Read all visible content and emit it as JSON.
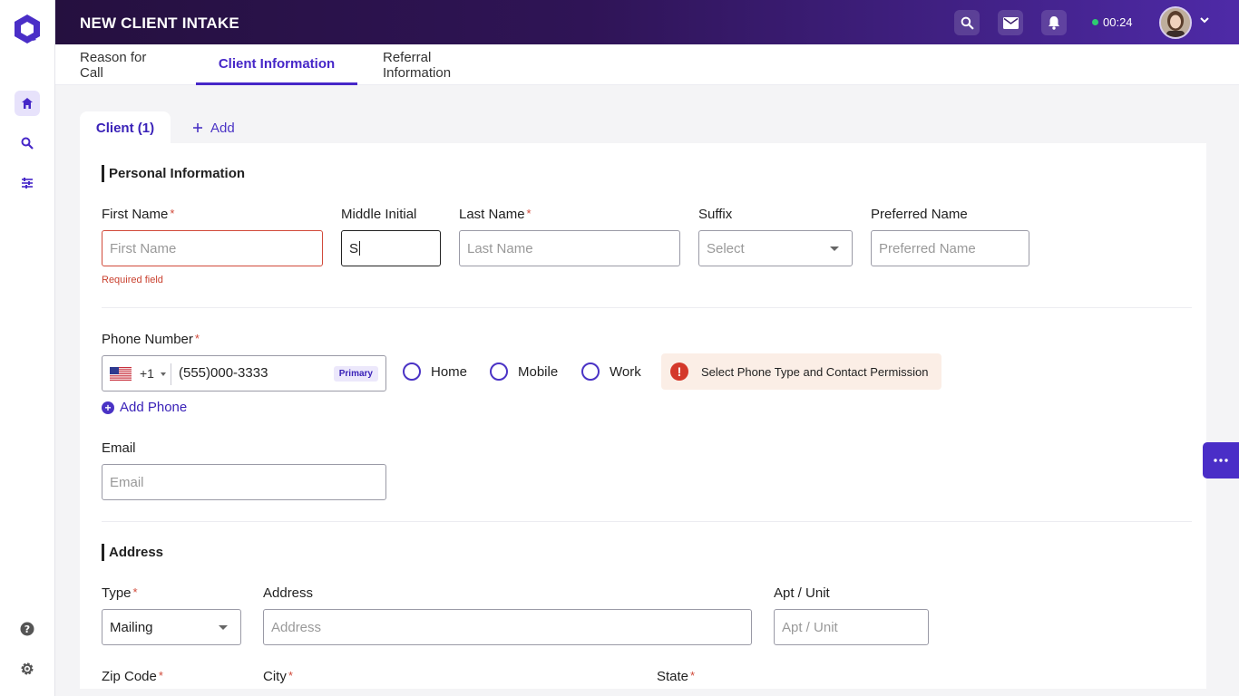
{
  "app": {
    "title": "NEW CLIENT INTAKE",
    "timer": "00:24"
  },
  "icons": {
    "logo": "hexagon-logo-icon",
    "home": "home-icon",
    "search": "search-icon",
    "filters": "sliders-icon",
    "help": "help-icon",
    "settings": "gear-icon",
    "mail": "mail-icon",
    "bell": "bell-icon",
    "more": "more-icon"
  },
  "colors": {
    "accent": "#4627c8",
    "error": "#d14a3a",
    "topbar_start": "#25103f",
    "topbar_end": "#4e2aa7"
  },
  "tabs": [
    {
      "label": "Reason for Call"
    },
    {
      "label": "Client Information"
    },
    {
      "label": "Referral Information"
    }
  ],
  "subtabs": {
    "client": "Client (1)",
    "add": "Add"
  },
  "personal": {
    "title": "Personal Information",
    "first_name": {
      "label": "First Name",
      "placeholder": "First Name",
      "error": "Required field"
    },
    "middle_initial": {
      "label": "Middle Initial",
      "value": "S"
    },
    "last_name": {
      "label": "Last Name",
      "placeholder": "Last Name"
    },
    "suffix": {
      "label": "Suffix",
      "placeholder": "Select"
    },
    "preferred_name": {
      "label": "Preferred Name",
      "placeholder": "Preferred Name"
    }
  },
  "phone": {
    "label": "Phone Number",
    "country_code": "+1",
    "value": "(555)000-3333",
    "badge": "Primary",
    "types": [
      "Home",
      "Mobile",
      "Work"
    ],
    "alert": "Select Phone Type and Contact Permission",
    "add_label": "Add Phone"
  },
  "email": {
    "label": "Email",
    "placeholder": "Email"
  },
  "address": {
    "title": "Address",
    "type": {
      "label": "Type",
      "value": "Mailing"
    },
    "address": {
      "label": "Address",
      "placeholder": "Address"
    },
    "apt": {
      "label": "Apt / Unit",
      "placeholder": "Apt / Unit"
    },
    "zip": {
      "label": "Zip Code"
    },
    "city": {
      "label": "City"
    },
    "state": {
      "label": "State"
    }
  }
}
